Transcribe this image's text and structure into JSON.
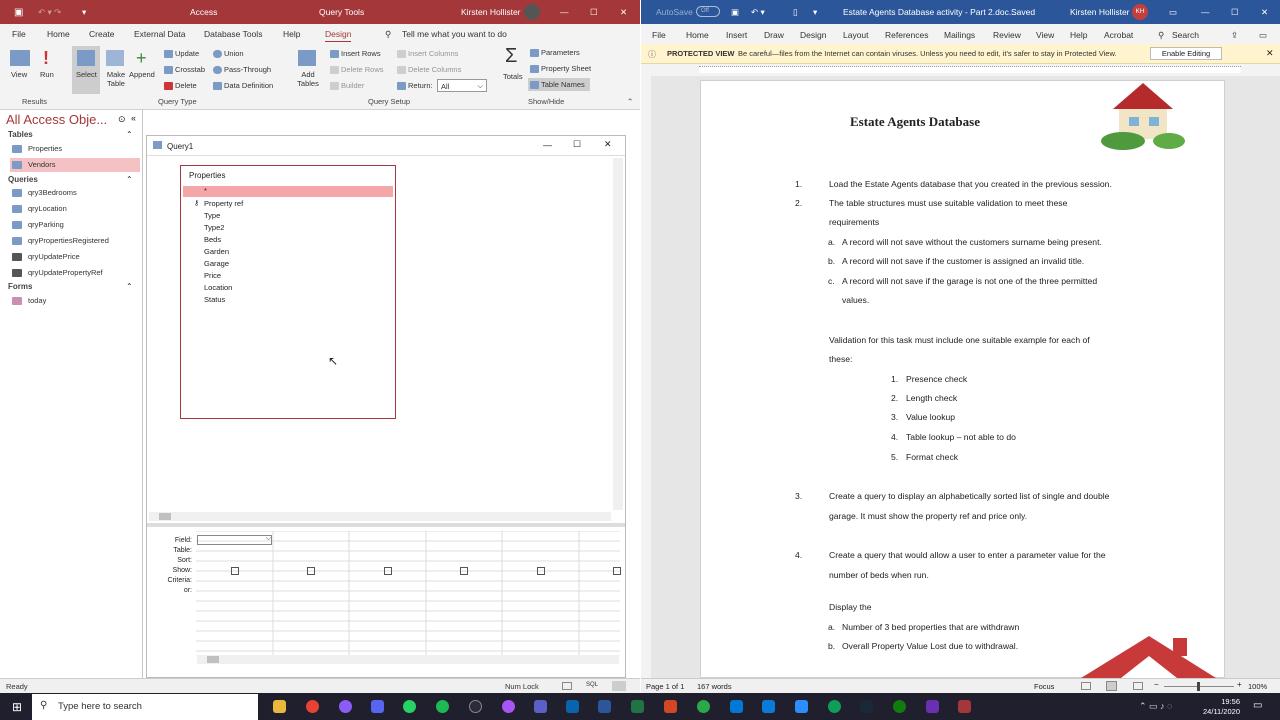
{
  "access": {
    "title": "Access",
    "context": "Query Tools",
    "user": "Kirsten Hollister",
    "tabs": [
      "File",
      "Home",
      "Create",
      "External Data",
      "Database Tools",
      "Help",
      "Design"
    ],
    "tell_me": "Tell me what you want to do",
    "ribbon": {
      "view": "View",
      "run": "Run",
      "select": "Select",
      "make_table": "Make Table",
      "append": "Append",
      "update": "Update",
      "crosstab": "Crosstab",
      "delete": "Delete",
      "union": "Union",
      "pass_through": "Pass-Through",
      "data_definition": "Data Definition",
      "add_tables": "Add Tables",
      "insert_rows": "Insert Rows",
      "delete_rows": "Delete Rows",
      "builder": "Builder",
      "insert_columns": "Insert Columns",
      "delete_columns": "Delete Columns",
      "return_label": "Return:",
      "return_value": "All",
      "totals": "Totals",
      "parameters": "Parameters",
      "property_sheet": "Property Sheet",
      "table_names": "Table Names",
      "groups": [
        "Results",
        "Query Type",
        "Query Setup",
        "Show/Hide"
      ]
    },
    "nav": {
      "header": "All Access Obje...",
      "tables_label": "Tables",
      "tables": [
        "Properties",
        "Vendors"
      ],
      "queries_label": "Queries",
      "queries": [
        "qry3Bedrooms",
        "qryLocation",
        "qryParking",
        "qryPropertiesRegistered",
        "qryUpdatePrice",
        "qryUpdatePropertyRef"
      ],
      "forms_label": "Forms",
      "forms": [
        "today"
      ]
    },
    "query": {
      "window_title": "Query1",
      "table_name": "Properties",
      "fields": [
        "*",
        "Property ref",
        "Type",
        "Type2",
        "Beds",
        "Garden",
        "Garage",
        "Price",
        "Location",
        "Status"
      ],
      "grid_labels": [
        "Field:",
        "Table:",
        "Sort:",
        "Show:",
        "Criteria:",
        "or:"
      ]
    },
    "status": {
      "left": "Ready",
      "num_lock": "Num Lock",
      "sql": "SQL"
    }
  },
  "word": {
    "autosave": "AutoSave",
    "autosave_state": "Off",
    "title": "Estate Agents Database activity - Part 2.doc...",
    "saved": "Saved",
    "user": "Kirsten Hollister",
    "initials": "KH",
    "tabs": [
      "File",
      "Home",
      "Insert",
      "Draw",
      "Design",
      "Layout",
      "References",
      "Mailings",
      "Review",
      "View",
      "Help",
      "Acrobat"
    ],
    "search": "Search",
    "protected_label": "PROTECTED VIEW",
    "protected_text": "Be careful—files from the Internet can contain viruses. Unless you need to edit, it's safer to stay in Protected View.",
    "enable_editing": "Enable Editing",
    "doc": {
      "heading": "Estate Agents Database",
      "i1": "Load the Estate Agents database that you created in the previous session.",
      "i2a": "The table structures must use suitable validation to meet these",
      "i2b": "requirements",
      "a1": "A record will not save without the customers surname being present.",
      "b1": "A record will not save if the customer is assigned an invalid title.",
      "c1a": "A record will not save if the garage is not one of the three permitted",
      "c1b": "values.",
      "val_a": "Validation for this task must include one suitable example for each of",
      "val_b": "these:",
      "checks": [
        "Presence check",
        "Length check",
        "Value lookup",
        "Table lookup – not able to do",
        "Format check"
      ],
      "i3a": "Create a query to display an alphabetically sorted list of single and double",
      "i3b": "garage. It must show the property ref and price only.",
      "i4a": "Create a query that would allow a user to enter a parameter value for the",
      "i4b": "number of beds when run.",
      "display": "Display the",
      "d_a": "Number of 3 bed properties that are withdrawn",
      "d_b": "Overall Property Value Lost due to withdrawal."
    },
    "status": {
      "page": "Page 1 of 1",
      "words": "167 words",
      "focus": "Focus",
      "zoom": "100%"
    }
  },
  "taskbar": {
    "search_placeholder": "Type here to search",
    "time": "19:56",
    "date": "24/11/2020"
  }
}
